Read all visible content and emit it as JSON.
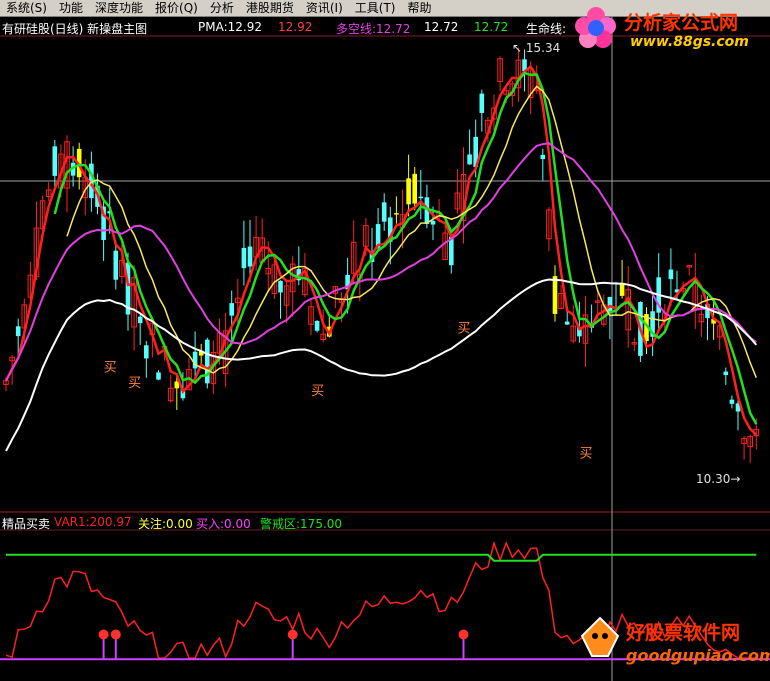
{
  "menu": [
    "系统(S)",
    "功能",
    "深度功能",
    "报价(Q)",
    "分析",
    "港股期货",
    "资讯(I)",
    "工具(T)",
    "帮助"
  ],
  "main_panel": {
    "title": "有研硅股(日线) 新操盘主图",
    "pma": "PMA:12.92",
    "v2": "12.92",
    "duokong_label": "多空线:12.72",
    "v4": "12.72",
    "v5": "12.72",
    "lifeline": "生命线:",
    "high_label": "15.34",
    "low_label": "10.30",
    "buy_text": "买"
  },
  "indicator_panel": {
    "title": "精品买卖",
    "var1": "VAR1:200.97",
    "guanzhu": "关注:0.00",
    "mairu": "买入:0.00",
    "jingjie": "警戒区:175.00"
  },
  "logos": {
    "top_cn": "分析家公式网",
    "top_url": "www.88gs.com",
    "bottom_cn": "好股票软件网",
    "bottom_url": "goodgupiao.com"
  },
  "colors": {
    "up": "#ff2020",
    "down": "#54ffff",
    "yellow_candle": "#ffff00",
    "ma_green": "#20e020",
    "ma_yellow": "#f8e860",
    "ma_magenta": "#e040e0",
    "ma_white": "#ffffff",
    "ma_olive": "#a0a060",
    "ind_red": "#ff2020",
    "ind_green": "#20e020",
    "ind_magenta": "#d040ff"
  },
  "chart_data": {
    "type": "candlestick",
    "price_axis_labels": [
      "15.34",
      "10.30"
    ],
    "main_ma_series": [
      "PMA",
      "多空线",
      "生命线"
    ],
    "indicator": {
      "title": "精品买卖",
      "series": [
        {
          "name": "VAR1",
          "last": 200.97
        },
        {
          "name": "关注",
          "last": 0.0
        },
        {
          "name": "买入",
          "last": 0.0
        },
        {
          "name": "警戒区",
          "last": 175.0
        }
      ]
    }
  }
}
